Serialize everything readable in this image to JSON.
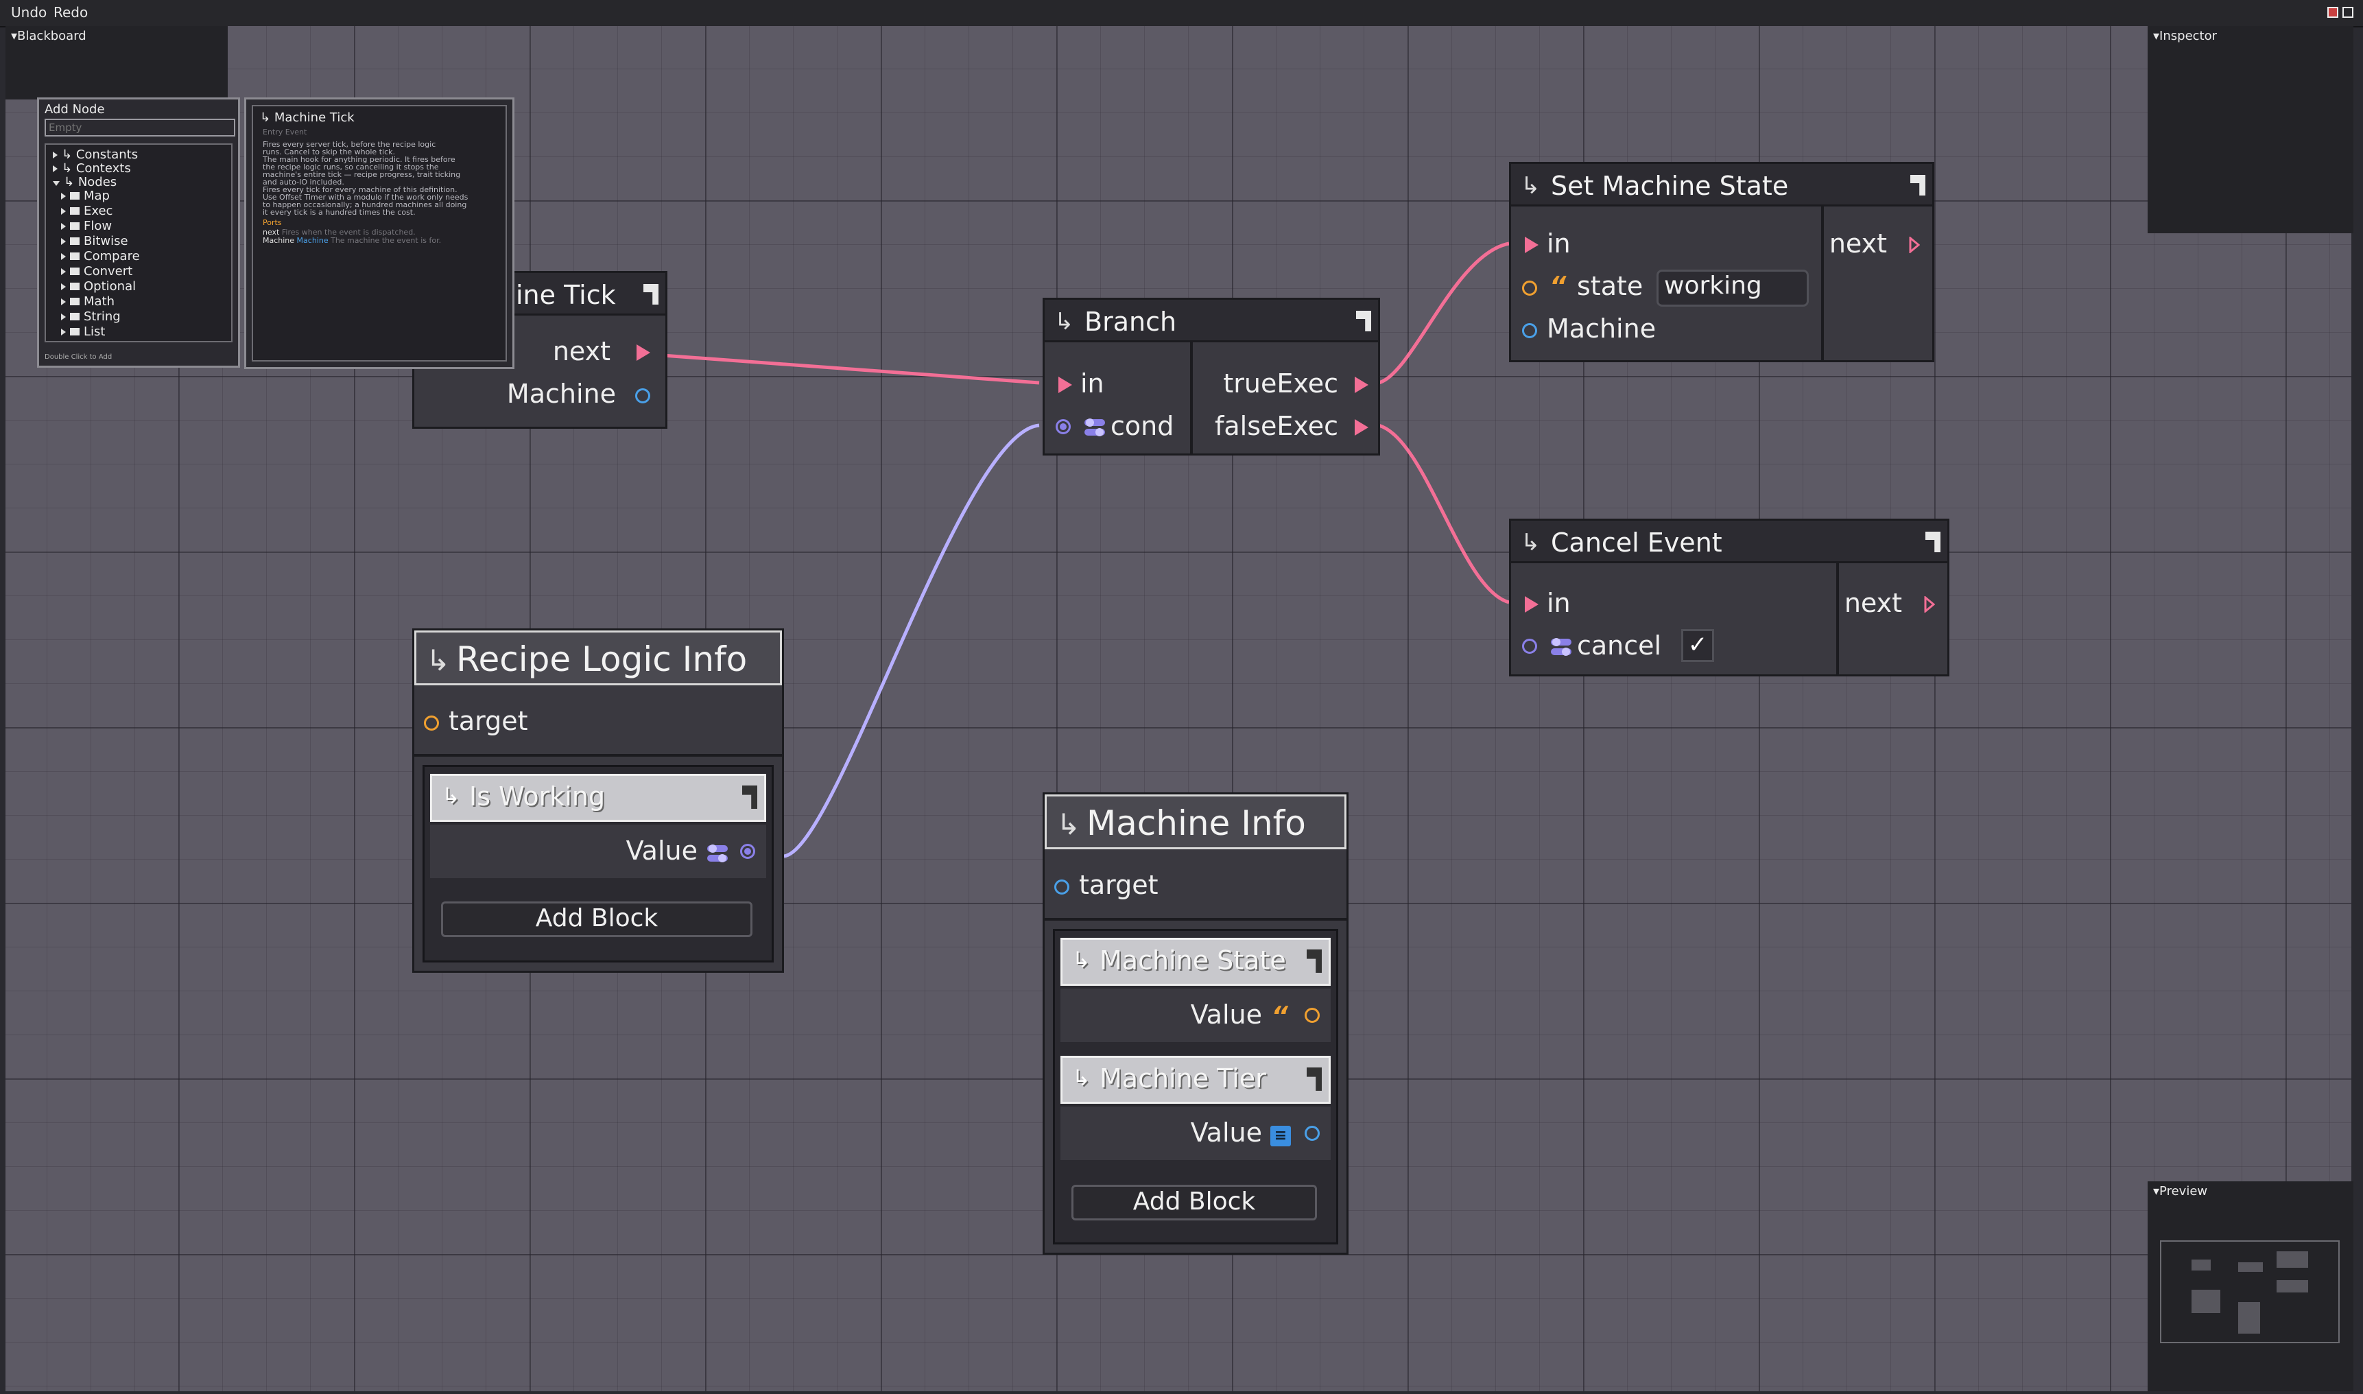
{
  "toolbar": {
    "undo": "Undo",
    "redo": "Redo"
  },
  "panels": {
    "blackboard": "Blackboard",
    "inspector": "Inspector",
    "preview": "Preview"
  },
  "add_node": {
    "title": "Add Node",
    "search_placeholder": "Empty",
    "footer": "Double Click to Add",
    "tree": [
      "Constants",
      "Contexts",
      "Nodes",
      "Map",
      "Exec",
      "Flow",
      "Bitwise",
      "Compare",
      "Convert",
      "Optional",
      "Math",
      "String",
      "List"
    ]
  },
  "doc_popup": {
    "title": "Machine Tick",
    "subtitle": "Entry Event",
    "lines": [
      "Fires every server tick, before the recipe logic",
      "runs. Cancel to skip the whole tick.",
      "The main hook for anything periodic. It fires before",
      "the recipe logic runs, so cancelling it stops the",
      "machine's entire tick — recipe progress, trait ticking",
      "and auto-IO included.",
      "Fires every tick for every machine of this definition.",
      "Use Offset Timer with a modulo if the work only needs",
      "to happen occasionally; a hundred machines all doing",
      "it every tick is a hundred times the cost."
    ],
    "ports_label": "Ports",
    "ports": [
      {
        "name": "next",
        "desc": "Fires when the event is dispatched."
      },
      {
        "name": "Machine",
        "type": "Machine",
        "desc": "The machine the event is for."
      }
    ]
  },
  "nodes": {
    "machine_tick": {
      "title": "Machine Tick",
      "title_visible": "ine Tick",
      "next": "next",
      "machine": "Machine"
    },
    "branch": {
      "title": "Branch",
      "in": "in",
      "cond": "cond",
      "true_exec": "trueExec",
      "false_exec": "falseExec"
    },
    "set_machine_state": {
      "title": "Set Machine State",
      "in": "in",
      "state": "state",
      "state_value": "working",
      "machine": "Machine",
      "next": "next"
    },
    "cancel_event": {
      "title": "Cancel Event",
      "in": "in",
      "cancel": "cancel",
      "cancel_checked": "✓",
      "next": "next"
    },
    "recipe_logic_info": {
      "title": "Recipe Logic Info",
      "target": "target",
      "blocks": [
        {
          "title": "Is Working",
          "value": "Value"
        }
      ],
      "add_block": "Add Block"
    },
    "machine_info": {
      "title": "Machine Info",
      "target": "target",
      "blocks": [
        {
          "title": "Machine State",
          "value": "Value"
        },
        {
          "title": "Machine Tier",
          "value": "Value"
        }
      ],
      "add_block": "Add Block"
    }
  },
  "colors": {
    "exec": "#f36f96",
    "bool": "#8a80e8",
    "object": "#4aa0e8",
    "string": "#f0a030",
    "int": "#3a8ee0"
  }
}
